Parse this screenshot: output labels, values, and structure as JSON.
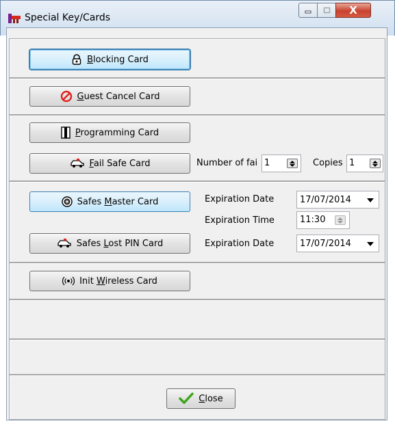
{
  "window": {
    "title": "Special Key/Cards",
    "close_glyph": "X"
  },
  "buttons": {
    "blocking": {
      "pre": "",
      "key": "B",
      "post": "locking Card",
      "icon": "lock-icon"
    },
    "guest_cancel": {
      "pre": "",
      "key": "G",
      "post": "uest Cancel Card",
      "icon": "prohibited-icon"
    },
    "programming": {
      "pre": "",
      "key": "P",
      "post": "rogramming Card",
      "icon": "card-icon"
    },
    "fail_safe": {
      "pre": "",
      "key": "F",
      "post": "ail Safe Card",
      "icon": "car-icon"
    },
    "safes_master": {
      "pre": "Safes ",
      "key": "M",
      "post": "aster Card",
      "icon": "safe-dial-icon"
    },
    "safes_lost_pin": {
      "pre": "Safes ",
      "key": "L",
      "post": "ost PIN Card",
      "icon": "car-icon"
    },
    "init_wireless": {
      "pre": "Init ",
      "key": "W",
      "post": "ireless Card",
      "icon": "wireless-icon"
    },
    "close": {
      "pre": "",
      "key": "C",
      "post": "lose",
      "icon": "checkmark-icon"
    }
  },
  "fail_safe_options": {
    "number_label": "Number of fai",
    "number_value": "1",
    "copies_label": "Copies",
    "copies_value": "1"
  },
  "safes_master_options": {
    "expiration_date_label": "Expiration Date",
    "expiration_date_value": "17/07/2014",
    "expiration_time_label": "Expiration Time",
    "expiration_time_value": "11:30"
  },
  "safes_lost_pin_options": {
    "expiration_date_label": "Expiration Date",
    "expiration_date_value": "17/07/2014"
  },
  "colors": {
    "accent": "#3c7fb1",
    "prohibited": "#e0201b",
    "check": "#3aa51a"
  }
}
